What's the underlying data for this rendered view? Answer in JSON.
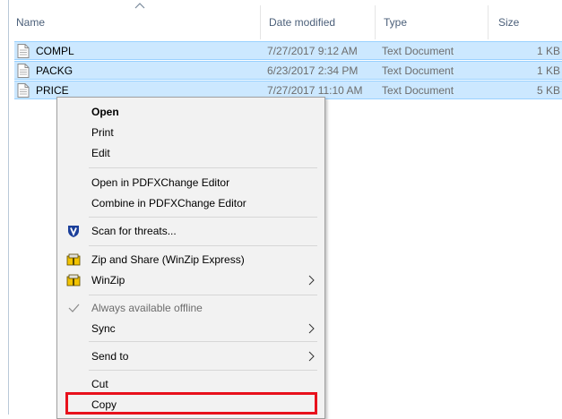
{
  "columns": {
    "name": "Name",
    "date_modified": "Date modified",
    "type": "Type",
    "size": "Size"
  },
  "files": [
    {
      "name": "COMPL",
      "date": "7/27/2017 9:12 AM",
      "type": "Text Document",
      "size": "1 KB"
    },
    {
      "name": "PACKG",
      "date": "6/23/2017 2:34 PM",
      "type": "Text Document",
      "size": "1 KB"
    },
    {
      "name": "PRICE",
      "date": "7/27/2017 11:10 AM",
      "type": "Text Document",
      "size": "5 KB"
    }
  ],
  "context_menu": {
    "open": "Open",
    "print": "Print",
    "edit": "Edit",
    "open_pdfx": "Open in PDFXChange Editor",
    "combine_pdfx": "Combine in PDFXChange Editor",
    "scan": "Scan for threats...",
    "zip_share": "Zip and Share (WinZip Express)",
    "winzip": "WinZip",
    "offline": "Always available offline",
    "sync": "Sync",
    "send_to": "Send to",
    "cut": "Cut",
    "copy": "Copy"
  },
  "colors": {
    "selection": "#cce8ff",
    "selection_border": "#99d1ff",
    "highlight_box": "#e8111c",
    "menu_bg": "#f2f2f2"
  },
  "icons": {
    "file": "text-document-icon",
    "sort": "sort-ascending-icon",
    "scan": "shield-icon",
    "zip": "winzip-icon",
    "check": "checkmark-icon",
    "submenu": "chevron-right-icon"
  }
}
